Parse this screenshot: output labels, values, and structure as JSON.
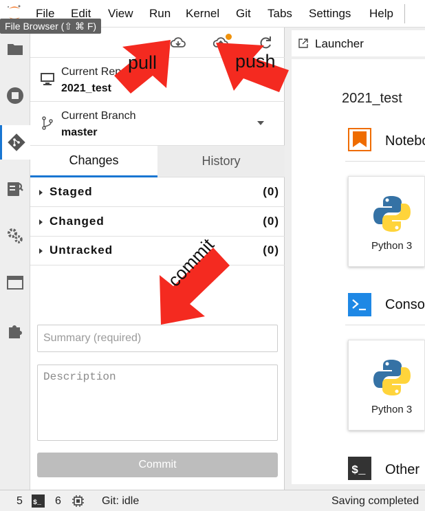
{
  "menubar": {
    "items": [
      "File",
      "Edit",
      "View",
      "Run",
      "Kernel",
      "Git",
      "Tabs",
      "Settings",
      "Help"
    ],
    "tooltip": "File Browser (⇧ ⌘ F)"
  },
  "activitybar": {
    "icons": [
      "folder-icon",
      "running-icon",
      "git-icon",
      "property-inspector-icon",
      "settings-icon",
      "tabs-icon",
      "extension-icon"
    ]
  },
  "git": {
    "toolbar": {
      "pull_icon": "cloud-download-icon",
      "push_icon": "cloud-upload-icon",
      "refresh_icon": "refresh-icon"
    },
    "repo_label": "Current Repository",
    "repo_value": "2021_test",
    "branch_label": "Current Branch",
    "branch_value": "master",
    "tabs": {
      "changes": "Changes",
      "history": "History"
    },
    "sections": [
      {
        "label": "Staged",
        "count": "(0)"
      },
      {
        "label": "Changed",
        "count": "(0)"
      },
      {
        "label": "Untracked",
        "count": "(0)"
      }
    ],
    "summary_placeholder": "Summary (required)",
    "description_placeholder": "Description",
    "commit_label": "Commit"
  },
  "launcher": {
    "tab_label": "Launcher",
    "title": "2021_test",
    "categories": [
      {
        "label": "Notebook",
        "icon": "notebook-icon",
        "card": "Python 3"
      },
      {
        "label": "Console",
        "icon": "console-icon",
        "card": "Python 3"
      },
      {
        "label": "Other",
        "icon": "terminal-icon"
      }
    ]
  },
  "statusbar": {
    "terminals": "5",
    "kernels": "6",
    "git_status": "Git: idle",
    "message": "Saving completed"
  },
  "annotations": {
    "pull": "pull",
    "push": "push",
    "commit": "commit"
  },
  "colors": {
    "accent": "#1976d2",
    "annotation_arrow": "#f42a20",
    "jupyter_orange": "#f37726",
    "badge": "#f0920c"
  }
}
